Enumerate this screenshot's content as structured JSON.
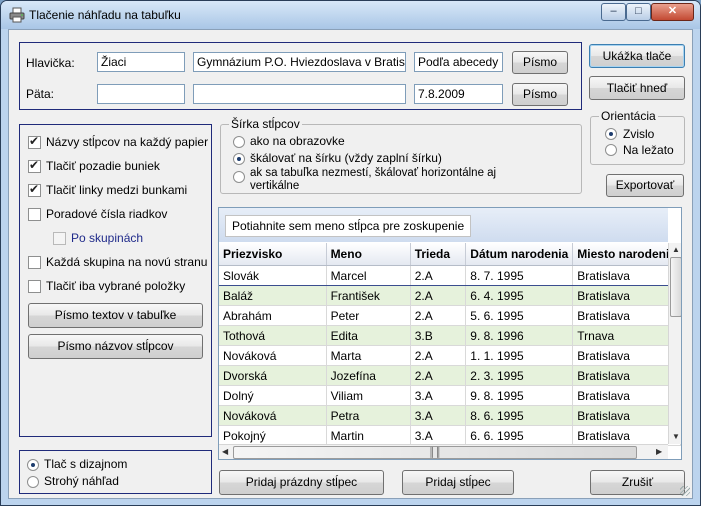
{
  "window": {
    "title": "Tlačenie náhľadu na tabuľku"
  },
  "header_section": {
    "header_label": "Hlavička:",
    "header_values": [
      "Žiaci",
      "Gymnázium P.O. Hviezdoslava v Bratislave",
      "Podľa abecedy"
    ],
    "footer_label": "Päta:",
    "footer_values": [
      "",
      "",
      "7.8.2009"
    ],
    "font_button": "Písmo"
  },
  "buttons": {
    "preview": "Ukážka tlače",
    "print_now": "Tlačiť hneď",
    "export": "Exportovať",
    "text_font": "Písmo textov v tabuľke",
    "column_font": "Písmo názvov stĺpcov",
    "add_empty_column": "Pridaj prázdny stĺpec",
    "add_column": "Pridaj stĺpec",
    "cancel": "Zrušiť"
  },
  "orientation": {
    "title": "Orientácia",
    "options": [
      {
        "label": "Zvislo",
        "checked": true
      },
      {
        "label": "Na ležato",
        "checked": false
      }
    ]
  },
  "column_width": {
    "title": "Šírka stĺpcov",
    "options": [
      {
        "label": "ako na obrazovke",
        "checked": false
      },
      {
        "label": "škálovať na šírku (vždy zaplní šírku)",
        "checked": true
      },
      {
        "label": "ak sa tabuľka nezmestí, škálovať horizontálne aj",
        "label2": "vertikálne",
        "checked": false
      }
    ]
  },
  "options": [
    {
      "label": "Názvy stĺpcov na každý papier",
      "checked": true
    },
    {
      "label": "Tlačiť pozadie buniek",
      "checked": true
    },
    {
      "label": "Tlačiť linky medzi bunkami",
      "checked": true
    },
    {
      "label": "Poradové čísla riadkov",
      "checked": false
    },
    {
      "label": "Po skupinách",
      "checked": false
    },
    {
      "label": "Každá skupina na novú stranu",
      "checked": false
    },
    {
      "label": "Tlačiť iba vybrané položky",
      "checked": false
    }
  ],
  "mode": {
    "options": [
      {
        "label": "Tlač s dizajnom",
        "checked": true
      },
      {
        "label": "Strohý náhľad",
        "checked": false
      }
    ]
  },
  "grid": {
    "group_hint": "Potiahnite sem meno stĺpca pre zoskupenie",
    "columns": [
      "Priezvisko",
      "Meno",
      "Trieda",
      "Dátum narodenia",
      "Miesto narodenia"
    ],
    "rows": [
      [
        "Slovák",
        "Marcel",
        "2.A",
        "8. 7. 1995",
        "Bratislava"
      ],
      [
        "Baláž",
        "František",
        "2.A",
        "6. 4. 1995",
        "Bratislava"
      ],
      [
        "Abrahám",
        "Peter",
        "2.A",
        "5. 6. 1995",
        "Bratislava"
      ],
      [
        "Tothová",
        "Edita",
        "3.B",
        "9. 8. 1996",
        "Trnava"
      ],
      [
        "Nováková",
        "Marta",
        "2.A",
        "1. 1. 1995",
        "Bratislava"
      ],
      [
        "Dvorská",
        "Jozefína",
        "2.A",
        "2. 3. 1995",
        "Bratislava"
      ],
      [
        "Dolný",
        "Viliam",
        "3.A",
        "9. 8. 1995",
        "Bratislava"
      ],
      [
        "Nováková",
        "Petra",
        "3.A",
        "8. 6. 1995",
        "Bratislava"
      ],
      [
        "Pokojný",
        "Martin",
        "3.A",
        "6. 6. 1995",
        "Bratislava"
      ]
    ]
  }
}
